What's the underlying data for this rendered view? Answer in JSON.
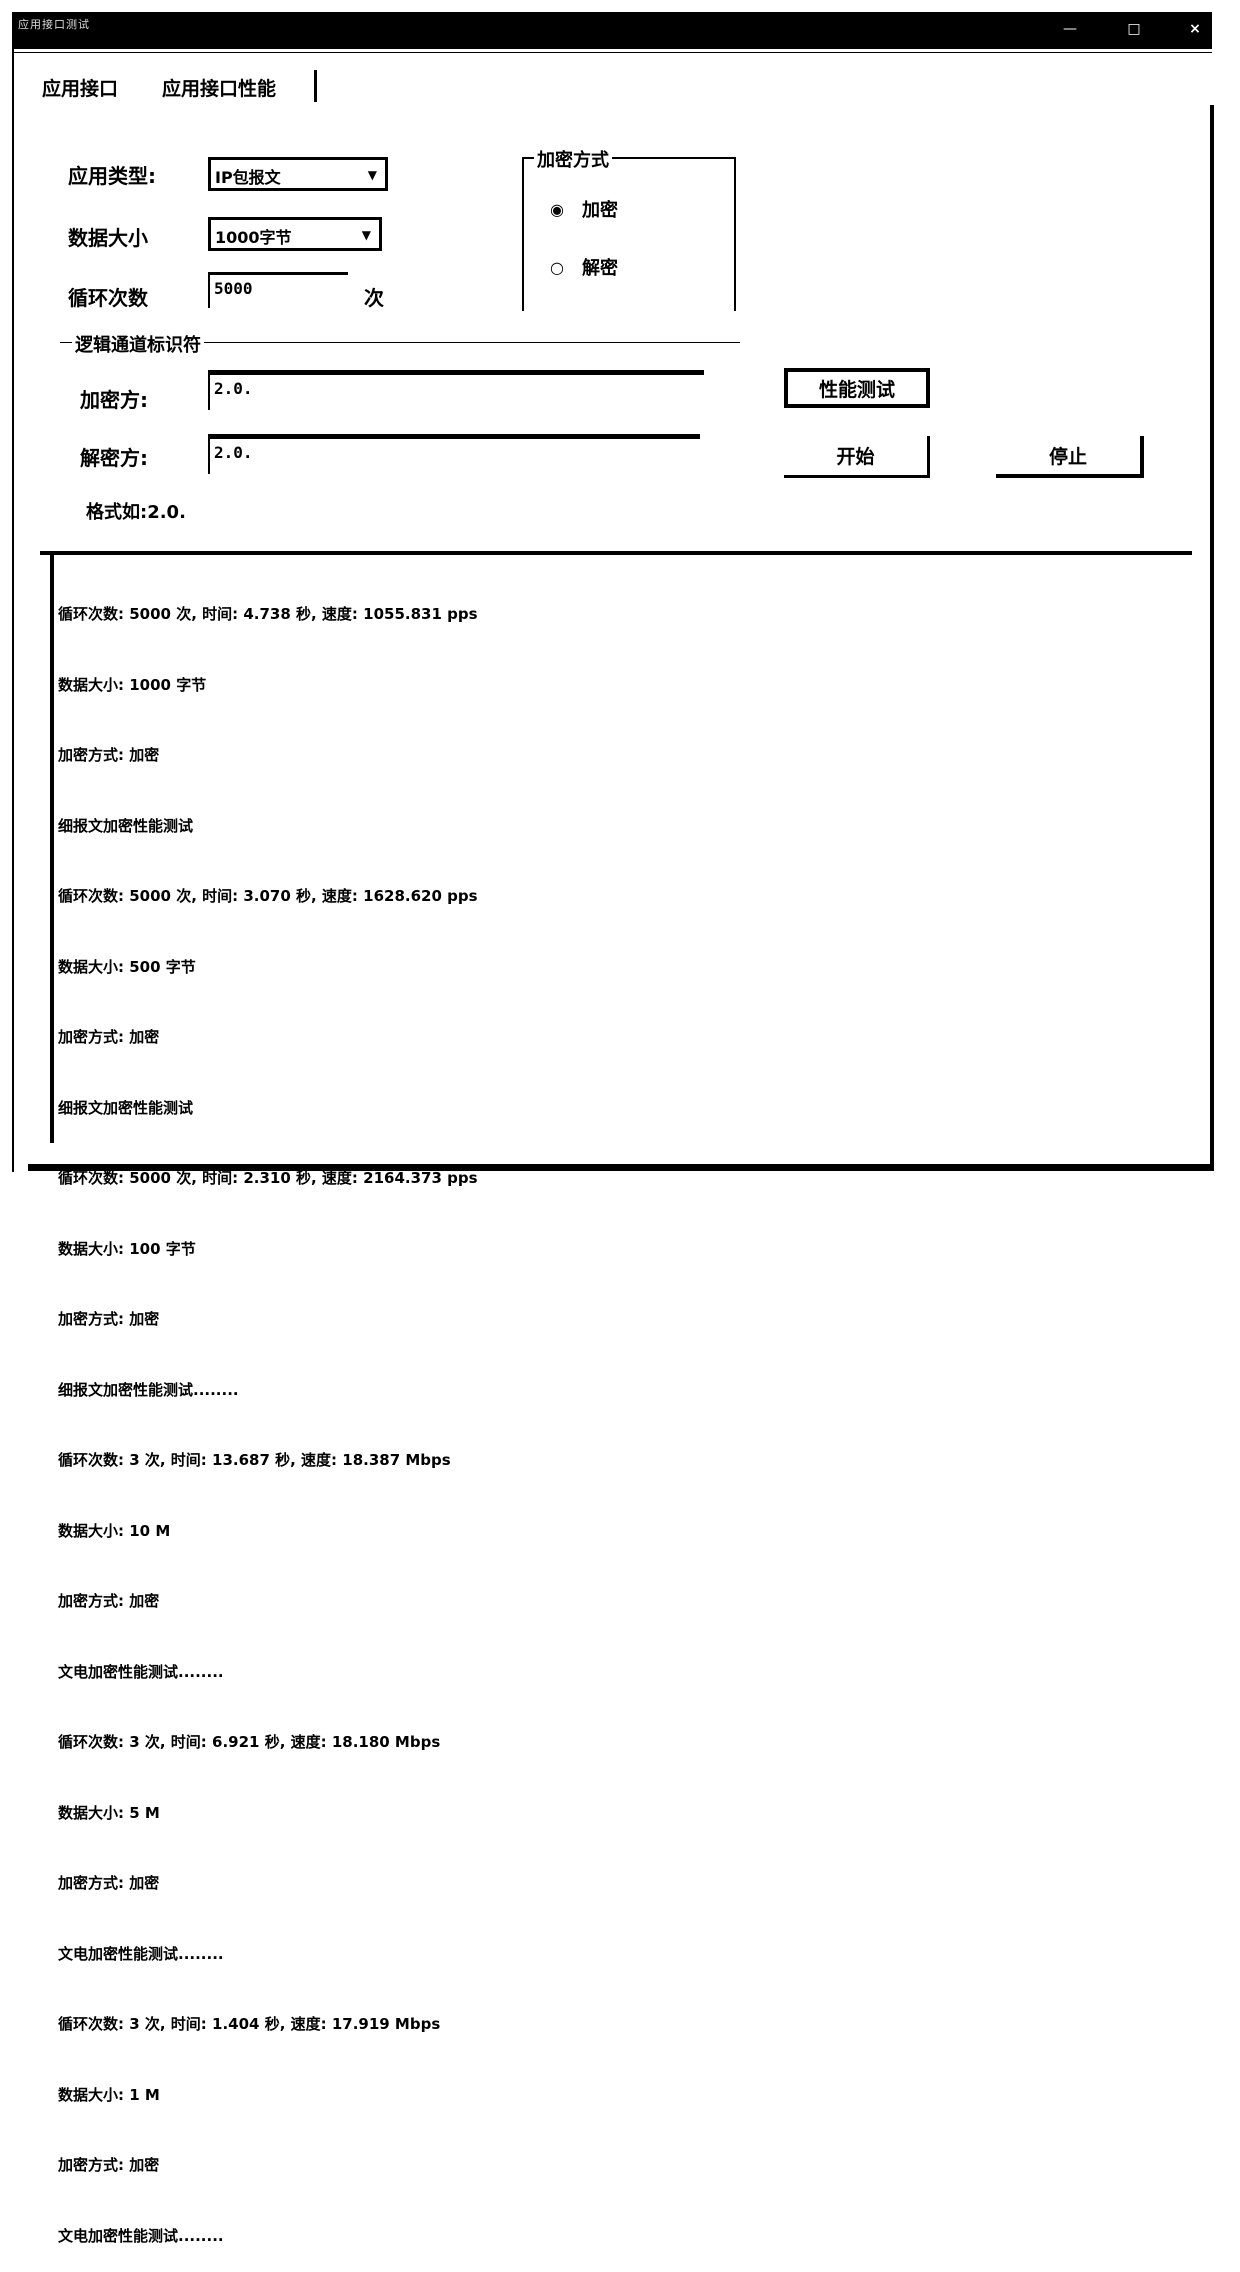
{
  "window": {
    "title": "应用接口测试",
    "minimize_label": "—",
    "maximize_label": "□",
    "close_label": "×"
  },
  "tabs": [
    {
      "label": "应用接口",
      "active": false
    },
    {
      "label": "应用接口性能",
      "active": true
    }
  ],
  "form": {
    "app_type_label": "应用类型:",
    "app_type_value": "IP包报文",
    "data_size_label": "数据大小",
    "data_size_value": "1000字节",
    "loop_count_label": "循环次数",
    "loop_count_value": "5000",
    "loop_count_unit": "次"
  },
  "crypto_mode": {
    "group_label": "加密方式",
    "options": [
      {
        "label": "加密",
        "selected": true
      },
      {
        "label": "解密",
        "selected": false
      }
    ],
    "selected_glyph": "◉",
    "unselected_glyph": "○"
  },
  "channel": {
    "group_label": "逻辑通道标识符",
    "encryptor_label": "加密方:",
    "encryptor_value": "2.0.",
    "decryptor_label": "解密方:",
    "decryptor_value": "2.0.",
    "format_hint": "格式如:2.0."
  },
  "buttons": {
    "perf_test": "性能测试",
    "start": "开始",
    "stop": "停止"
  },
  "log": {
    "lines": [
      "循环次数: 5000 次, 时间: 4.738 秒, 速度: 1055.831 pps",
      "数据大小: 1000 字节",
      "加密方式: 加密",
      "细报文加密性能测试",
      "循环次数: 5000 次, 时间: 3.070 秒, 速度: 1628.620 pps",
      "数据大小: 500 字节",
      "加密方式: 加密",
      "细报文加密性能测试",
      "循环次数: 5000 次, 时间: 2.310 秒, 速度: 2164.373 pps",
      "数据大小: 100 字节",
      "加密方式: 加密",
      "细报文加密性能测试........",
      "循环次数: 3 次, 时间: 13.687 秒, 速度: 18.387 Mbps",
      "数据大小: 10 M",
      "加密方式: 加密",
      "文电加密性能测试........",
      "循环次数: 3 次, 时间: 6.921 秒, 速度: 18.180 Mbps",
      "数据大小: 5 M",
      "加密方式: 加密",
      "文电加密性能测试........",
      "循环次数: 3 次, 时间: 1.404 秒, 速度: 17.919 Mbps",
      "数据大小: 1 M",
      "加密方式: 加密",
      "文电加密性能测试........"
    ]
  }
}
